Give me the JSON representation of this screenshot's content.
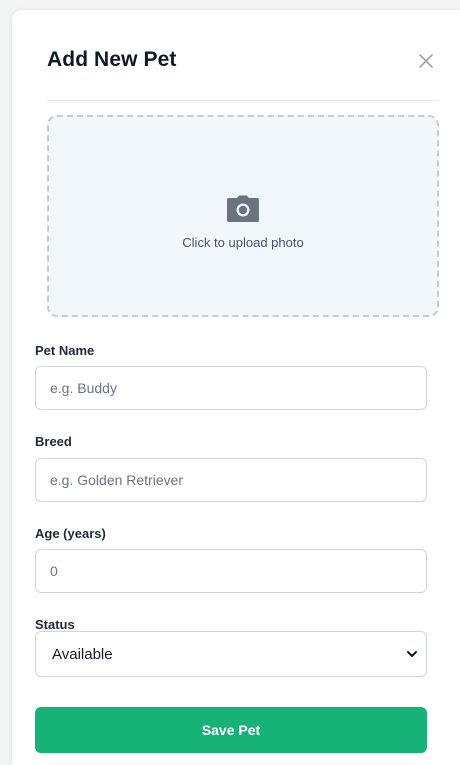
{
  "modal": {
    "title": "Add New Pet",
    "close_icon": "close-icon"
  },
  "upload": {
    "icon": "camera-icon",
    "text": "Click to upload photo"
  },
  "fields": {
    "pet_name": {
      "label": "Pet Name",
      "placeholder": "e.g. Buddy",
      "value": ""
    },
    "breed": {
      "label": "Breed",
      "placeholder": "e.g. Golden Retriever",
      "value": ""
    },
    "age": {
      "label": "Age (years)",
      "placeholder": "0",
      "value": ""
    },
    "status": {
      "label": "Status",
      "selected": "Available"
    }
  },
  "actions": {
    "save_label": "Save Pet"
  },
  "colors": {
    "accent": "#16b277",
    "upload_bg": "#f2f7fb",
    "border": "#d1d5db"
  }
}
